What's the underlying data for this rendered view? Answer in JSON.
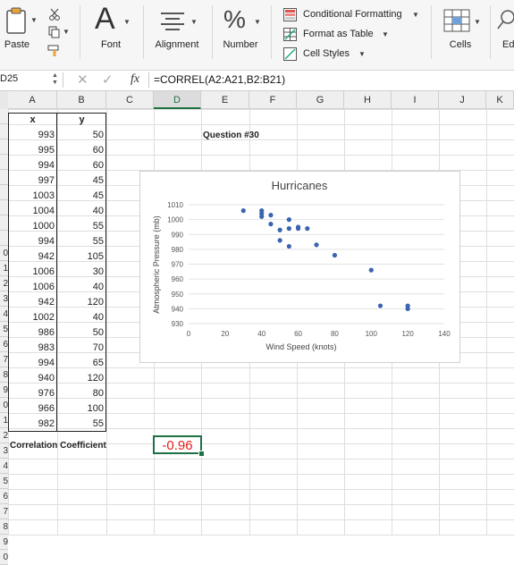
{
  "ribbon": {
    "paste_label": "Paste",
    "font_label": "Font",
    "alignment_label": "Alignment",
    "number_label": "Number",
    "conditional_formatting": "Conditional Formatting",
    "format_as_table": "Format as Table",
    "cell_styles": "Cell Styles",
    "cells_label": "Cells",
    "editing_label_partial": "Ed",
    "font_glyph": "A",
    "number_glyph": "%"
  },
  "formula_bar": {
    "name_box": "D25",
    "fx": "fx",
    "formula": "=CORREL(A2:A21,B2:B21)"
  },
  "columns": [
    "A",
    "B",
    "C",
    "D",
    "E",
    "F",
    "G",
    "H",
    "I",
    "J",
    "K"
  ],
  "row_numbers_visible": [
    "",
    "",
    "",
    "",
    "",
    "",
    "",
    "",
    "",
    "0",
    "1",
    "2",
    "3",
    "4",
    "5",
    "6",
    "7",
    "8",
    "9",
    "0",
    "1",
    "2",
    "3",
    "4",
    "5",
    "6",
    "7",
    "8",
    "9",
    "0"
  ],
  "headers": {
    "x": "x",
    "y": "y"
  },
  "rows": [
    [
      "993",
      "50"
    ],
    [
      "995",
      "60"
    ],
    [
      "994",
      "60"
    ],
    [
      "997",
      "45"
    ],
    [
      "1003",
      "45"
    ],
    [
      "1004",
      "40"
    ],
    [
      "1000",
      "55"
    ],
    [
      "994",
      "55"
    ],
    [
      "942",
      "105"
    ],
    [
      "1006",
      "30"
    ],
    [
      "1006",
      "40"
    ],
    [
      "942",
      "120"
    ],
    [
      "1002",
      "40"
    ],
    [
      "986",
      "50"
    ],
    [
      "983",
      "70"
    ],
    [
      "994",
      "65"
    ],
    [
      "940",
      "120"
    ],
    [
      "976",
      "80"
    ],
    [
      "966",
      "100"
    ],
    [
      "982",
      "55"
    ]
  ],
  "question_label": "Question #30",
  "correlation_label": "Correlation Coefficient",
  "correlation_value": "-0.96",
  "colors": {
    "accent_green": "#1e7145",
    "value_red": "#e0201b",
    "marker_blue": "#3a63b0"
  },
  "chart_data": {
    "type": "scatter",
    "title": "Hurricanes",
    "xlabel": "Wind Speed (knots)",
    "ylabel": "Atmospheric Pressure (mb)",
    "xlim": [
      0,
      140
    ],
    "ylim": [
      930,
      1010
    ],
    "xticks": [
      0,
      20,
      40,
      60,
      80,
      100,
      120,
      140
    ],
    "yticks": [
      930,
      940,
      950,
      960,
      970,
      980,
      990,
      1000,
      1010
    ],
    "x": [
      50,
      60,
      60,
      45,
      45,
      40,
      55,
      55,
      105,
      30,
      40,
      120,
      40,
      50,
      70,
      65,
      120,
      80,
      100,
      55
    ],
    "y": [
      993,
      995,
      994,
      997,
      1003,
      1004,
      1000,
      994,
      942,
      1006,
      1006,
      942,
      1002,
      986,
      983,
      994,
      940,
      976,
      966,
      982
    ]
  }
}
